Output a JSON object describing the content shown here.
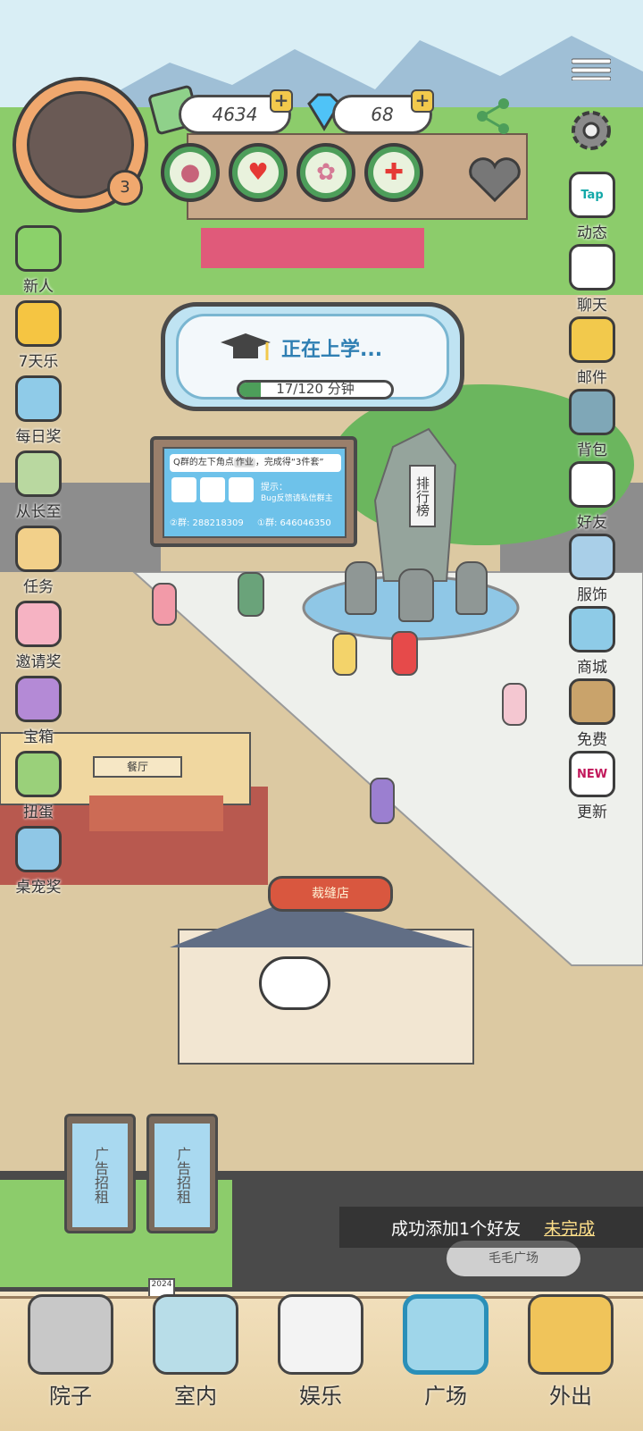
{
  "hud": {
    "level": "3",
    "coins": "4634",
    "diamonds": "68",
    "plus_symbol": "+"
  },
  "study_panel": {
    "status": "正在上学...",
    "progress_text": "17/120 分钟",
    "progress_fraction": 0.14
  },
  "notice_board": {
    "line1": "Q群的左下角点",
    "tag": "作业",
    "line1b": "，完成得“3件套”",
    "hint_label": "提示：",
    "hint_text": "Bug反馈请私信群主",
    "group2": "②群: 288218309",
    "group1": "①群: 646046350"
  },
  "landmarks": {
    "ranking": "排行榜",
    "restaurant": "餐厅",
    "tailor": "裁缝店",
    "ad_left": "广告招租",
    "ad_right": "广告招租",
    "plaza_sign": "毛毛广场",
    "calendar": "2024"
  },
  "left_menu": [
    {
      "label": "新人",
      "icon": "gift-icon"
    },
    {
      "label": "7天乐",
      "icon": "seven-days-icon"
    },
    {
      "label": "每日奖",
      "icon": "video-reward-icon"
    },
    {
      "label": "从长至",
      "icon": "cat-statue-icon"
    },
    {
      "label": "任务",
      "icon": "task-clipboard-icon"
    },
    {
      "label": "邀请奖",
      "icon": "invite-panda-icon"
    },
    {
      "label": "宝箱",
      "icon": "treasure-chest-icon"
    },
    {
      "label": "扭蛋",
      "icon": "gacha-machine-icon"
    },
    {
      "label": "桌宠奖",
      "icon": "desk-pet-icon"
    }
  ],
  "right_menu": [
    {
      "label": "动态",
      "icon": "tap-icon",
      "badge": "Tap"
    },
    {
      "label": "聊天",
      "icon": "chat-bubble-icon"
    },
    {
      "label": "邮件",
      "icon": "mail-icon"
    },
    {
      "label": "背包",
      "icon": "backpack-icon"
    },
    {
      "label": "好友",
      "icon": "friends-panda-icon"
    },
    {
      "label": "服饰",
      "icon": "clothing-icon"
    },
    {
      "label": "商城",
      "icon": "shop-icon"
    },
    {
      "label": "免费",
      "icon": "free-house-icon"
    },
    {
      "label": "更新",
      "icon": "update-icon",
      "badge": "NEW"
    }
  ],
  "toast": {
    "message": "成功添加1个好友",
    "status": "未完成"
  },
  "bottom_nav": [
    {
      "label": "院子",
      "icon": "yard-house-icon"
    },
    {
      "label": "室内",
      "icon": "indoor-bed-icon"
    },
    {
      "label": "娱乐",
      "icon": "gamepad-icon"
    },
    {
      "label": "广场",
      "icon": "plaza-building-icon",
      "active": true
    },
    {
      "label": "外出",
      "icon": "outing-suitcase-icon"
    }
  ],
  "colors": {
    "sky": "#d9eef5",
    "grass": "#8ccc6b",
    "path": "#dcc9a2",
    "plaza_tile": "#eef0ec",
    "accent_green": "#4d9e5a",
    "panel_blue": "#bfe3f2"
  }
}
